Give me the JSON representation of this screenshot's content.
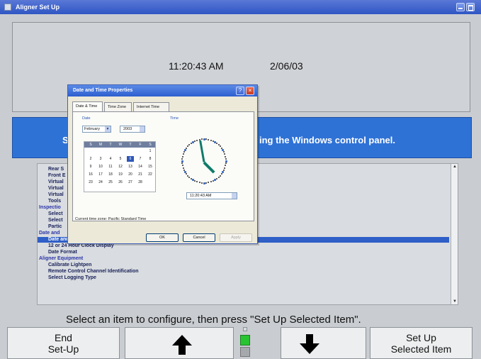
{
  "window": {
    "title": "Aligner Set Up"
  },
  "clock": {
    "time": "11:20:43 AM",
    "date": "2/06/03"
  },
  "banner": {
    "left_text": "Se",
    "right_text": "ing the Windows control panel."
  },
  "list": {
    "items": [
      {
        "label": "Rear S",
        "type": "child"
      },
      {
        "label": "Front E",
        "type": "child"
      },
      {
        "label": "Virtual",
        "type": "child"
      },
      {
        "label": "Virtual",
        "type": "child"
      },
      {
        "label": "Virtual",
        "type": "child"
      },
      {
        "label": "Tools",
        "type": "child"
      },
      {
        "label": "Inspectio",
        "type": "group"
      },
      {
        "label": "Select",
        "type": "child"
      },
      {
        "label": "Select",
        "type": "child"
      },
      {
        "label": "Partic",
        "type": "child"
      },
      {
        "label": "Date and",
        "type": "group"
      },
      {
        "label": "Date and Time",
        "type": "selected"
      },
      {
        "label": "12 or 24 Hour Clock Display",
        "type": "child"
      },
      {
        "label": "Date Format",
        "type": "child"
      },
      {
        "label": "Aligner Equipment",
        "type": "group"
      },
      {
        "label": "Calibrate Lightpen",
        "type": "child"
      },
      {
        "label": "Remote Control Channel Identification",
        "type": "child"
      },
      {
        "label": "Select Logging Type",
        "type": "child"
      }
    ]
  },
  "instruction": "Select an item to configure, then press \"Set Up Selected Item\".",
  "buttons": {
    "end_line1": "End",
    "end_line2": "Set-Up",
    "setup_line1": "Set Up",
    "setup_line2": "Selected Item"
  },
  "dialog": {
    "title": "Date and Time Properties",
    "tabs": [
      "Date & Time",
      "Time Zone",
      "Internet Time"
    ],
    "date_label": "Date",
    "time_label": "Time",
    "month": "February",
    "year": "2003",
    "days_header": [
      "S",
      "M",
      "T",
      "W",
      "T",
      "F",
      "S"
    ],
    "calendar_days": [
      "1",
      "2",
      "3",
      "4",
      "5",
      "6",
      "7",
      "8",
      "9",
      "10",
      "11",
      "12",
      "13",
      "14",
      "15",
      "16",
      "17",
      "18",
      "19",
      "20",
      "21",
      "22",
      "23",
      "24",
      "25",
      "26",
      "27",
      "28"
    ],
    "selected_day": "6",
    "time_value": "11:20:43 AM",
    "timezone_text": "Current time zone: Pacific Standard Time",
    "ok": "OK",
    "cancel": "Cancel",
    "apply": "Apply"
  },
  "colors": {
    "banner": "#2f72d6",
    "selected": "#2f5fc7",
    "indicator_green": "#28c431"
  },
  "icons": {
    "up_arrow": "up-arrow-icon",
    "down_arrow": "down-arrow-icon"
  }
}
